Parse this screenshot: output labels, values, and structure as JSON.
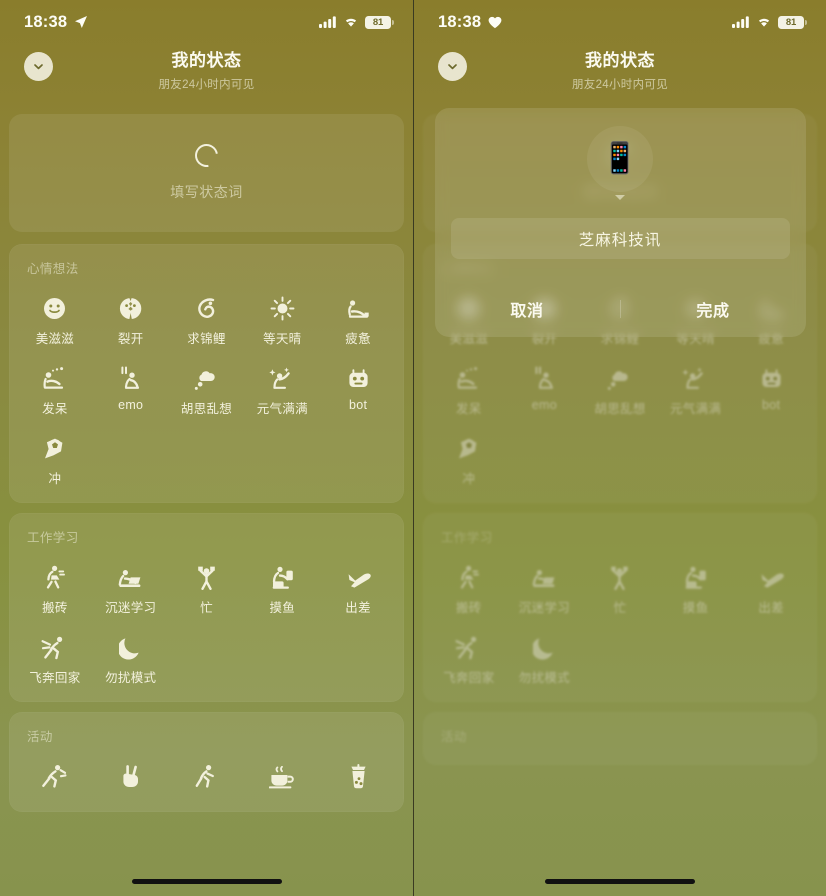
{
  "left": {
    "statusbar": {
      "time": "18:38",
      "left_icon": "location-arrow-icon",
      "battery_level": "81"
    },
    "header": {
      "title": "我的状态",
      "subtitle": "朋友24小时内可见",
      "collapse_icon": "chevron-down-icon"
    },
    "status_input": {
      "icon": "ring-icon",
      "placeholder": "填写状态词"
    },
    "sections": [
      {
        "title": "心情想法",
        "items": [
          {
            "icon": "smiling-face-icon",
            "label": "美滋滋"
          },
          {
            "icon": "cracked-face-icon",
            "label": "裂开"
          },
          {
            "icon": "koi-fish-icon",
            "label": "求锦鲤"
          },
          {
            "icon": "sun-icon",
            "label": "等天晴"
          },
          {
            "icon": "tired-person-icon",
            "label": "疲惫"
          },
          {
            "icon": "daydream-icon",
            "label": "发呆"
          },
          {
            "icon": "emo-person-icon",
            "label": "emo"
          },
          {
            "icon": "thought-cloud-icon",
            "label": "胡思乱想"
          },
          {
            "icon": "sparkle-person-icon",
            "label": "元气满满"
          },
          {
            "icon": "robot-icon",
            "label": "bot"
          },
          {
            "icon": "soccer-ball-icon",
            "label": "冲"
          }
        ]
      },
      {
        "title": "工作学习",
        "items": [
          {
            "icon": "carrying-bricks-icon",
            "label": "搬砖"
          },
          {
            "icon": "studying-icon",
            "label": "沉迷学习"
          },
          {
            "icon": "busy-person-icon",
            "label": "忙"
          },
          {
            "icon": "slacking-icon",
            "label": "摸鱼"
          },
          {
            "icon": "airplane-icon",
            "label": "出差"
          },
          {
            "icon": "running-home-icon",
            "label": "飞奔回家"
          },
          {
            "icon": "crescent-moon-icon",
            "label": "勿扰模式"
          }
        ]
      },
      {
        "title": "活动",
        "items": [
          {
            "icon": "running-icon",
            "label": ""
          },
          {
            "icon": "victory-hand-icon",
            "label": ""
          },
          {
            "icon": "jogging-icon",
            "label": ""
          },
          {
            "icon": "coffee-cup-icon",
            "label": ""
          },
          {
            "icon": "bubble-tea-icon",
            "label": ""
          }
        ]
      }
    ]
  },
  "right": {
    "statusbar": {
      "time": "18:38",
      "left_icon": "heart-icon",
      "battery_level": "81"
    },
    "header": {
      "title": "我的状态",
      "subtitle": "朋友24小时内可见",
      "collapse_icon": "chevron-down-icon"
    },
    "modal": {
      "avatar_emoji": "📱",
      "avatar_icon": "mobile-phone-icon",
      "caret_icon": "caret-down-icon",
      "input_value": "芝麻科技讯",
      "cancel_label": "取消",
      "confirm_label": "完成"
    }
  },
  "colors": {
    "bg_top": "#8a7d2c",
    "bg_bottom": "#87934d",
    "card": "rgba(255,255,255,0.085)",
    "text": "#f3f1dd",
    "muted": "rgba(246,244,226,0.58)"
  }
}
